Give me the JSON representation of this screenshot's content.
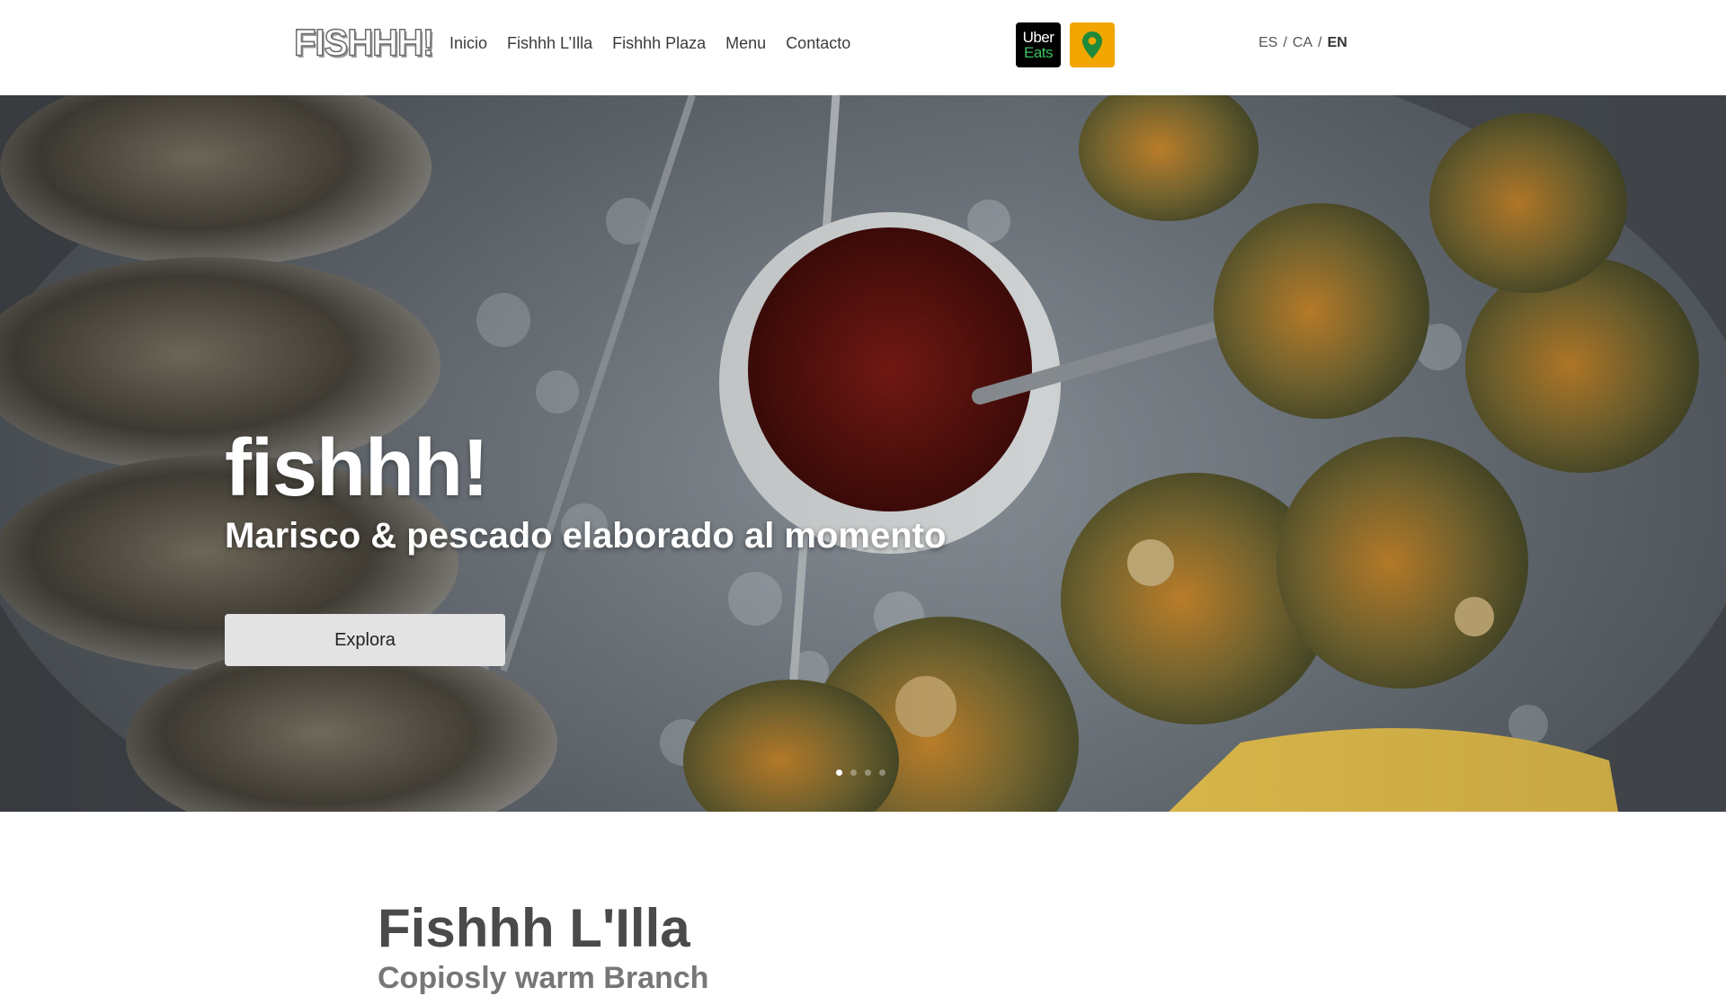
{
  "header": {
    "logo": "FISHHH!",
    "nav": [
      "Inicio",
      "Fishhh L’Illa",
      "Fishhh Plaza",
      "Menu",
      "Contacto"
    ],
    "uber_eats": {
      "line1": "Uber",
      "line2": "Eats"
    },
    "map_icon": "map-pin-icon",
    "languages": [
      "ES",
      "CA",
      "EN"
    ],
    "language_separator": "/",
    "active_language": "EN"
  },
  "hero": {
    "title": "fishhh!",
    "subtitle": "Marisco & pescado elaborado al momento",
    "button_label": "Explora",
    "slide_count": 4,
    "active_slide": 1
  },
  "section": {
    "title": "Fishhh L'Illa",
    "subtitle": "Copiosly warm Branch"
  },
  "colors": {
    "map_badge": "#f2a600",
    "uber_green": "#3fc060",
    "button_bg": "#e3e3e3"
  }
}
